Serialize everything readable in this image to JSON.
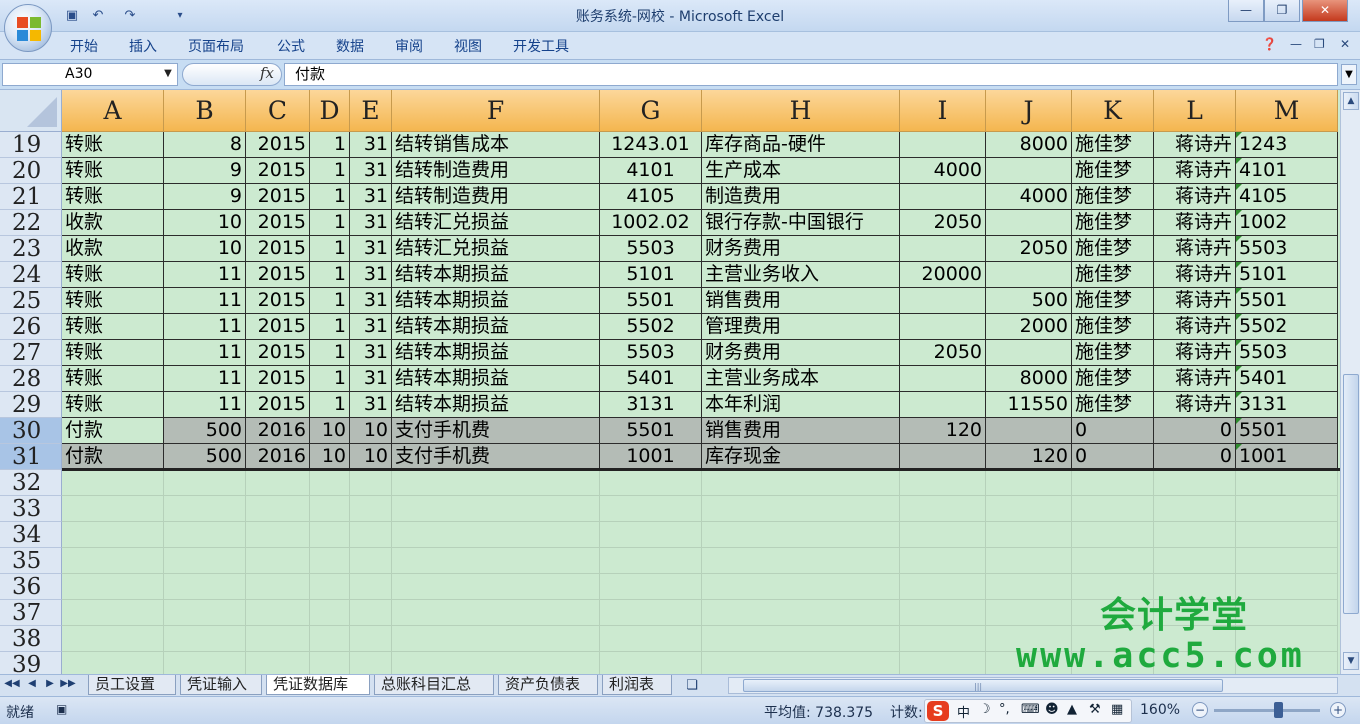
{
  "window": {
    "title": "账务系统-网校 - Microsoft Excel"
  },
  "ribbon": {
    "tabs": [
      "开始",
      "插入",
      "页面布局",
      "公式",
      "数据",
      "审阅",
      "视图",
      "开发工具"
    ]
  },
  "formula_bar": {
    "name_box": "A30",
    "fx": "fx",
    "content": "付款"
  },
  "columns": [
    "A",
    "B",
    "C",
    "D",
    "E",
    "F",
    "G",
    "H",
    "I",
    "J",
    "K",
    "L",
    "M"
  ],
  "rows": [
    {
      "num": "19",
      "cells": [
        "转账",
        "8",
        "2015",
        "1",
        "31",
        "结转销售成本",
        "1243.01",
        "库存商品-硬件",
        "",
        "8000",
        "施佳梦",
        "蒋诗卉",
        "1243"
      ]
    },
    {
      "num": "20",
      "cells": [
        "转账",
        "9",
        "2015",
        "1",
        "31",
        "结转制造费用",
        "4101",
        "生产成本",
        "4000",
        "",
        "施佳梦",
        "蒋诗卉",
        "4101"
      ]
    },
    {
      "num": "21",
      "cells": [
        "转账",
        "9",
        "2015",
        "1",
        "31",
        "结转制造费用",
        "4105",
        "制造费用",
        "",
        "4000",
        "施佳梦",
        "蒋诗卉",
        "4105"
      ]
    },
    {
      "num": "22",
      "cells": [
        "收款",
        "10",
        "2015",
        "1",
        "31",
        "结转汇兑损益",
        "1002.02",
        "银行存款-中国银行",
        "2050",
        "",
        "施佳梦",
        "蒋诗卉",
        "1002"
      ]
    },
    {
      "num": "23",
      "cells": [
        "收款",
        "10",
        "2015",
        "1",
        "31",
        "结转汇兑损益",
        "5503",
        "财务费用",
        "",
        "2050",
        "施佳梦",
        "蒋诗卉",
        "5503"
      ]
    },
    {
      "num": "24",
      "cells": [
        "转账",
        "11",
        "2015",
        "1",
        "31",
        "结转本期损益",
        "5101",
        "主营业务收入",
        "20000",
        "",
        "施佳梦",
        "蒋诗卉",
        "5101"
      ]
    },
    {
      "num": "25",
      "cells": [
        "转账",
        "11",
        "2015",
        "1",
        "31",
        "结转本期损益",
        "5501",
        "销售费用",
        "",
        "500",
        "施佳梦",
        "蒋诗卉",
        "5501"
      ]
    },
    {
      "num": "26",
      "cells": [
        "转账",
        "11",
        "2015",
        "1",
        "31",
        "结转本期损益",
        "5502",
        "管理费用",
        "",
        "2000",
        "施佳梦",
        "蒋诗卉",
        "5502"
      ]
    },
    {
      "num": "27",
      "cells": [
        "转账",
        "11",
        "2015",
        "1",
        "31",
        "结转本期损益",
        "5503",
        "财务费用",
        "2050",
        "",
        "施佳梦",
        "蒋诗卉",
        "5503"
      ]
    },
    {
      "num": "28",
      "cells": [
        "转账",
        "11",
        "2015",
        "1",
        "31",
        "结转本期损益",
        "5401",
        "主营业务成本",
        "",
        "8000",
        "施佳梦",
        "蒋诗卉",
        "5401"
      ]
    },
    {
      "num": "29",
      "cells": [
        "转账",
        "11",
        "2015",
        "1",
        "31",
        "结转本期损益",
        "3131",
        "本年利润",
        "",
        "11550",
        "施佳梦",
        "蒋诗卉",
        "3131"
      ]
    },
    {
      "num": "30",
      "selected": true,
      "cells": [
        "付款",
        "500",
        "2016",
        "10",
        "10",
        "支付手机费",
        "5501",
        "销售费用",
        "120",
        "",
        "0",
        "0",
        "5501"
      ]
    },
    {
      "num": "31",
      "selected": true,
      "cells": [
        "付款",
        "500",
        "2016",
        "10",
        "10",
        "支付手机费",
        "1001",
        "库存现金",
        "",
        "120",
        "0",
        "0",
        "1001"
      ]
    },
    {
      "num": "32",
      "cells": []
    },
    {
      "num": "33",
      "cells": []
    },
    {
      "num": "34",
      "cells": []
    },
    {
      "num": "35",
      "cells": []
    },
    {
      "num": "36",
      "cells": []
    },
    {
      "num": "37",
      "cells": []
    },
    {
      "num": "38",
      "cells": []
    },
    {
      "num": "39",
      "cells": []
    }
  ],
  "sheets": [
    "员工设置",
    "凭证输入",
    "凭证数据库",
    "总账科目汇总",
    "资产负债表",
    "利润表"
  ],
  "active_sheet": 2,
  "status": {
    "ready": "就绪",
    "average": "平均值: 738.375",
    "count_label": "计数:",
    "zoom": "160%"
  },
  "ime": {
    "logo": "S",
    "lang": "中"
  },
  "watermark": {
    "line1": "会计学堂",
    "line2": "www.acc5.com"
  },
  "colors": {
    "header_orange": "#f4b64f",
    "sheet_bg": "#ccead0",
    "selection_gray": "#b4bcb6",
    "watermark_green": "#1faa3e"
  }
}
